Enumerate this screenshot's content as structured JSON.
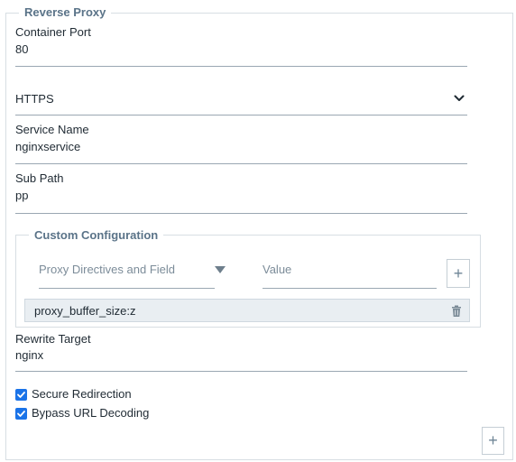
{
  "section": {
    "legend": "Reverse Proxy"
  },
  "container_port": {
    "label": "Container Port",
    "value": "80"
  },
  "protocol": {
    "value": "HTTPS",
    "icon": "chevron-down-icon"
  },
  "service_name": {
    "label": "Service Name",
    "value": "nginxservice"
  },
  "sub_path": {
    "label": "Sub Path",
    "value": "pp"
  },
  "custom_config": {
    "legend": "Custom Configuration",
    "directive_placeholder": "Proxy Directives and Field",
    "value_placeholder": "Value",
    "entries": [
      {
        "text": "proxy_buffer_size:z"
      }
    ]
  },
  "rewrite_target": {
    "label": "Rewrite Target",
    "value": "nginx"
  },
  "checkboxes": [
    {
      "label": "Secure Redirection",
      "checked": true
    },
    {
      "label": "Bypass URL Decoding",
      "checked": true
    }
  ],
  "colors": {
    "accent": "#1a73e8",
    "legend": "#5a7388",
    "chip": "#e9eef2"
  }
}
